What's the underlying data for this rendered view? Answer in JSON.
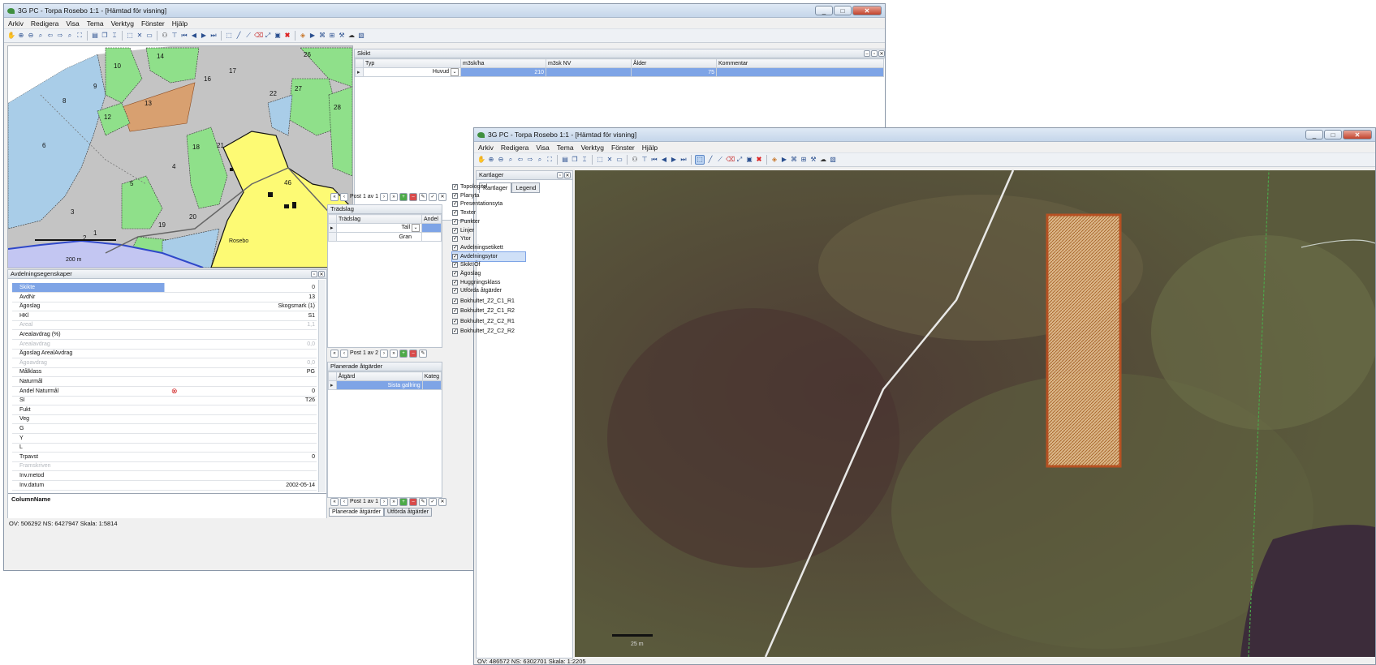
{
  "window1": {
    "title": "3G PC - Torpa Rosebo  1:1 - [Hämtad för visning]",
    "menu": [
      "Arkiv",
      "Redigera",
      "Visa",
      "Tema",
      "Verktyg",
      "Fönster",
      "Hjälp"
    ],
    "map": {
      "stand_numbers": [
        "10",
        "14",
        "26",
        "9",
        "16",
        "17",
        "13",
        "22",
        "27",
        "8",
        "28",
        "12",
        "6",
        "18",
        "21",
        "4",
        "5",
        "46",
        "3",
        "20",
        "19",
        "1",
        "2"
      ],
      "place_label": "Rosebo",
      "scale_label": "200 m"
    },
    "skikt": {
      "title": "Skikt",
      "columns": [
        "Typ",
        "m3sk/ha",
        "m3sk NV",
        "Ålder",
        "Kommentar"
      ],
      "row": {
        "typ": "Huvud",
        "m3sk_ha": "210",
        "m3sk_nv": "",
        "alder": "75",
        "kommentar": ""
      },
      "pager": "Post 1 av 1"
    },
    "tradslag": {
      "title": "Trädslag",
      "columns": [
        "Trädslag",
        "Andel"
      ],
      "rows": [
        "Tall",
        "Gran"
      ],
      "pager": "Post 1 av 2"
    },
    "planerade": {
      "title": "Planerade åtgärder",
      "columns": [
        "Åtgärd",
        "Kateg"
      ],
      "rows": [
        "Sista gallring"
      ],
      "pager": "Post 1 av 1",
      "tabs": [
        "Planerade åtgärder",
        "Utförda åtgärder"
      ]
    },
    "properties": {
      "title": "Avdelningsegenskaper",
      "rows": [
        {
          "key": "Skikte",
          "value": "0",
          "selected": true
        },
        {
          "key": "AvdNr",
          "value": "13"
        },
        {
          "key": "Ägoslag",
          "value": "Skogsmark (1)"
        },
        {
          "key": "HKl",
          "value": "S1"
        },
        {
          "key": "Areal",
          "value": "1,1",
          "dim": true
        },
        {
          "key": "Arealavdrag (%)",
          "value": ""
        },
        {
          "key": "Arealavdrag",
          "value": "0,0",
          "dim": true
        },
        {
          "key": "Ägoslag ArealAvdrag",
          "value": ""
        },
        {
          "key": "Ägoavdrag",
          "value": "0,0",
          "dim": true
        },
        {
          "key": "Målklass",
          "value": "PG"
        },
        {
          "key": "Naturmål",
          "value": ""
        },
        {
          "key": "Andel Naturmål",
          "value": "0",
          "error": true
        },
        {
          "key": "SI",
          "value": "T26"
        },
        {
          "key": "Fukt",
          "value": ""
        },
        {
          "key": "Veg",
          "value": ""
        },
        {
          "key": "G",
          "value": ""
        },
        {
          "key": "Y",
          "value": ""
        },
        {
          "key": "L",
          "value": ""
        },
        {
          "key": "Trpavst",
          "value": "0"
        },
        {
          "key": "Framskriven",
          "value": "",
          "dim": true
        },
        {
          "key": "Inv.metod",
          "value": ""
        },
        {
          "key": "Inv.datum",
          "value": "2002-05-14"
        }
      ],
      "description_label": "ColumnName"
    },
    "status": "OV: 506292  NS: 6427947   Skala: 1:5814"
  },
  "window2": {
    "title": "3G PC - Torpa Rosebo  1:1 - [Hämtad för visning]",
    "menu": [
      "Arkiv",
      "Redigera",
      "Visa",
      "Tema",
      "Verktyg",
      "Fönster",
      "Hjälp"
    ],
    "kartlager": {
      "title": "Kartlager",
      "tabs": [
        "Kartlager",
        "Legend"
      ],
      "layers": [
        "Topologitel",
        "Planyta",
        "Presentationsyta",
        "Texter",
        "Punkter",
        "Linjer",
        "Ytor",
        "Avdelningsetikett",
        "Avdelningsytor",
        "Skikt Öf",
        "Ägoslag",
        "Huggningsklass",
        "Utförda åtgärder",
        "Bokhultet_Z2_C1_R1",
        "Bokhultet_Z2_C1_R2",
        "Bokhultet_Z2_C2_R1",
        "Bokhultet_Z2_C2_R2"
      ],
      "selected_layer": "Avdelningsytor"
    },
    "scale_label": "25 m",
    "status": "OV: 486572  NS: 6302701   Skala: 1:2205"
  },
  "colors": {
    "forest_blue": "#a9cde8",
    "forest_green": "#8fe08a",
    "forest_grey": "#c4c4c4",
    "selected_yellow": "#fdfa74",
    "hatched_brown": "#d8a070",
    "water": "#c3c6f2",
    "selection_blue": "#7ea4e6"
  }
}
